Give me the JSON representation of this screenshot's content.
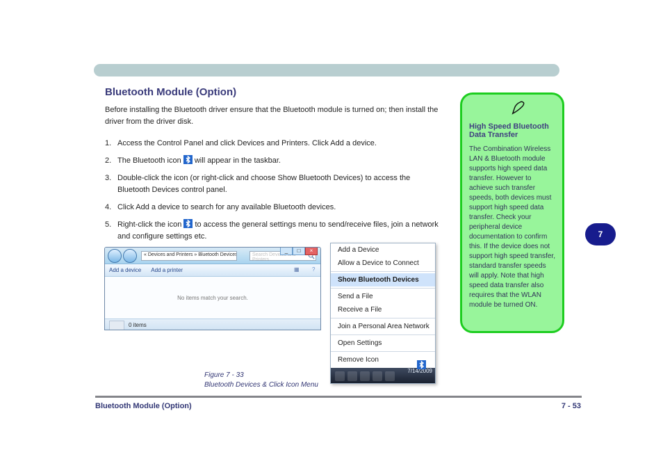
{
  "chapter_tag": "7",
  "header": {},
  "title": "Bluetooth Module (Option)",
  "intro": "Before installing the Bluetooth driver ensure that the Bluetooth module is turned on; then install the driver from the driver disk.",
  "steps": [
    "Access the Control Panel and click Devices and Printers. Click Add a device.",
    "The Bluetooth icon   will appear in the taskbar.",
    "Double-click the icon (or right-click and choose Show Bluetooth Devices) to access the Bluetooth Devices control panel.",
    "Click Add a device to search for any available Bluetooth devices.",
    "Right-click the icon   to access the general settings menu to send/receive files, join a network and configure settings etc."
  ],
  "note": {
    "title": "High Speed Bluetooth Data Transfer",
    "text": "The Combination Wireless LAN & Bluetooth module supports high speed data transfer. However to achieve such transfer speeds, both devices must support high speed data transfer. Check your peripheral device documentation to confirm this. If the device does not support high speed transfer, standard transfer speeds will apply. Note that high speed data transfer also requires that the WLAN module be turned ON."
  },
  "explorer": {
    "breadcrumb": "« Devices and Printers » Bluetooth Devices",
    "search_placeholder": "Search Devices and Printers",
    "cmd_add_device": "Add a device",
    "cmd_add_printer": "Add a printer",
    "body_msg": "No items match your search.",
    "status_items": "0 items",
    "win_min": "_",
    "win_max": "□",
    "win_close": "×"
  },
  "contextmenu": {
    "items": [
      "Add a Device",
      "Allow a Device to Connect",
      "Show Bluetooth Devices",
      "Send a File",
      "Receive a File",
      "Join a Personal Area Network",
      "Open Settings",
      "Remove Icon"
    ],
    "date": "7/14/2009"
  },
  "figure_labels": {
    "a": "Figure 7 - 33",
    "b": "Bluetooth Devices & Click Icon Menu"
  },
  "footer": {
    "left": "Bluetooth Module (Option)",
    "right": "7 - 53"
  }
}
